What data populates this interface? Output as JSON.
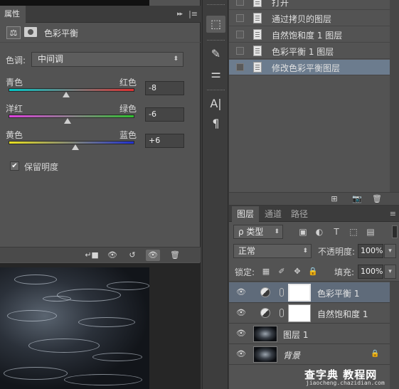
{
  "properties_panel": {
    "tab_label": "属性",
    "collapse_glyph": "▸▸",
    "menu_glyph": "|≡",
    "adjustment_title": "色彩平衡",
    "balance_icon_glyph": "⚖",
    "tone_label": "色调:",
    "tone_value": "中间调",
    "select_arrow": "⬍",
    "sliders": [
      {
        "left_label": "青色",
        "right_label": "红色",
        "value": "-8",
        "range": [
          -100,
          100
        ],
        "level": -8,
        "colors": [
          "#00c8c8",
          "#e03030"
        ]
      },
      {
        "left_label": "洋红",
        "right_label": "绿色",
        "value": "-6",
        "range": [
          -100,
          100
        ],
        "level": -6,
        "colors": [
          "#e040e0",
          "#30c030"
        ]
      },
      {
        "left_label": "黄色",
        "right_label": "蓝色",
        "value": "+6",
        "range": [
          -100,
          100
        ],
        "level": 6,
        "colors": [
          "#e8e020",
          "#2030d0"
        ]
      }
    ],
    "preserve_luminosity_label": "保留明度",
    "preserve_luminosity_checked": true,
    "check_glyph": "✔",
    "footer_icons": {
      "clip": "↵■",
      "view_prev": "👁",
      "reset": "↺",
      "visibility": "👁",
      "delete": "🗑"
    }
  },
  "toolstrip": {
    "tools": [
      {
        "name": "3d-icon",
        "glyph": "⬚"
      },
      {
        "name": "brush-icon",
        "glyph": "✎"
      },
      {
        "name": "adjust-icon",
        "glyph": "⚌"
      },
      {
        "name": "character-icon",
        "glyph": "A|"
      },
      {
        "name": "paragraph-icon",
        "glyph": "¶"
      }
    ]
  },
  "history": {
    "items": [
      {
        "label": "打开",
        "selected": false
      },
      {
        "label": "通过拷贝的图层",
        "selected": false
      },
      {
        "label": "自然饱和度 1 图层",
        "selected": false
      },
      {
        "label": "色彩平衡 1 图层",
        "selected": false
      },
      {
        "label": "修改色彩平衡图层",
        "selected": true
      }
    ],
    "footer_icons": {
      "new_doc": "⊞",
      "camera": "📷",
      "delete": "🗑"
    }
  },
  "layers_panel": {
    "tabs": [
      {
        "label": "图层",
        "active": true
      },
      {
        "label": "通道",
        "active": false
      },
      {
        "label": "路径",
        "active": false
      }
    ],
    "menu_glyph": "≡",
    "filter_kind": "ρ 类型",
    "filter_icons": [
      "▣",
      "◐",
      "T",
      "⬚",
      "▤"
    ],
    "blend_mode": "正常",
    "opacity_label": "不透明度:",
    "opacity_value": "100%",
    "lock_label": "锁定:",
    "lock_icons": [
      "▦",
      "✐",
      "✥",
      "🔒"
    ],
    "fill_label": "填充:",
    "fill_value": "100%",
    "dropdown_glyph": "▾",
    "layers": [
      {
        "name": "色彩平衡 1",
        "type": "adjustment",
        "selected": true,
        "italic": false
      },
      {
        "name": "自然饱和度 1",
        "type": "adjustment",
        "selected": false,
        "italic": false
      },
      {
        "name": "图层 1",
        "type": "pixel",
        "selected": false,
        "italic": false
      },
      {
        "name": "背景",
        "type": "pixel",
        "selected": false,
        "italic": true,
        "locked": true
      }
    ],
    "eye_glyph": "👁",
    "lock_glyph": "🔒"
  },
  "watermark": {
    "top": "查字典 教程网",
    "bottom": "jiaocheng.chazidian.com"
  }
}
